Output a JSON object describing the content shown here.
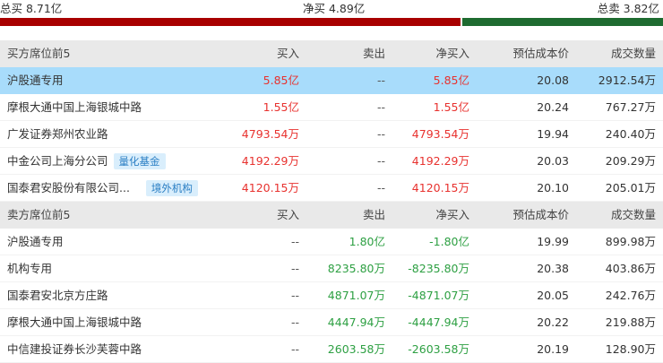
{
  "summary": {
    "buy_total": "总买 8.71亿",
    "net_total": "净买 4.89亿",
    "sell_total": "总卖 3.82亿",
    "buy_share": 0.695,
    "buy_color": "#a80000",
    "sell_color": "#1e6b30"
  },
  "buy_section": {
    "headers": {
      "name": "买方席位前5",
      "buy": "买入",
      "sell": "卖出",
      "net": "净买入",
      "cost": "预估成本价",
      "volume": "成交数量"
    },
    "rows": [
      {
        "name": "沪股通专用",
        "buy": "5.85亿",
        "sell": "--",
        "net": "5.85亿",
        "cost": "20.08",
        "volume": "2912.54万",
        "tag": ""
      },
      {
        "name": "摩根大通中国上海银城中路",
        "buy": "1.55亿",
        "sell": "--",
        "net": "1.55亿",
        "cost": "20.24",
        "volume": "767.27万",
        "tag": ""
      },
      {
        "name": "广发证券郑州农业路",
        "buy": "4793.54万",
        "sell": "--",
        "net": "4793.54万",
        "cost": "19.94",
        "volume": "240.40万",
        "tag": ""
      },
      {
        "name": "中金公司上海分公司",
        "buy": "4192.29万",
        "sell": "--",
        "net": "4192.29万",
        "cost": "20.03",
        "volume": "209.29万",
        "tag": "量化基金"
      },
      {
        "name": "国泰君安股份有限公司...",
        "buy": "4120.15万",
        "sell": "--",
        "net": "4120.15万",
        "cost": "20.10",
        "volume": "205.01万",
        "tag": "境外机构"
      }
    ]
  },
  "sell_section": {
    "headers": {
      "name": "卖方席位前5",
      "buy": "买入",
      "sell": "卖出",
      "net": "净买入",
      "cost": "预估成本价",
      "volume": "成交数量"
    },
    "rows": [
      {
        "name": "沪股通专用",
        "buy": "--",
        "sell": "1.80亿",
        "net": "-1.80亿",
        "cost": "19.99",
        "volume": "899.98万"
      },
      {
        "name": "机构专用",
        "buy": "--",
        "sell": "8235.80万",
        "net": "-8235.80万",
        "cost": "20.38",
        "volume": "403.86万"
      },
      {
        "name": "国泰君安北京方庄路",
        "buy": "--",
        "sell": "4871.07万",
        "net": "-4871.07万",
        "cost": "20.05",
        "volume": "242.76万"
      },
      {
        "name": "摩根大通中国上海银城中路",
        "buy": "--",
        "sell": "4447.94万",
        "net": "-4447.94万",
        "cost": "20.22",
        "volume": "219.88万"
      },
      {
        "name": "中信建投证券长沙芙蓉中路",
        "buy": "--",
        "sell": "2603.58万",
        "net": "-2603.58万",
        "cost": "20.19",
        "volume": "128.90万"
      }
    ]
  }
}
